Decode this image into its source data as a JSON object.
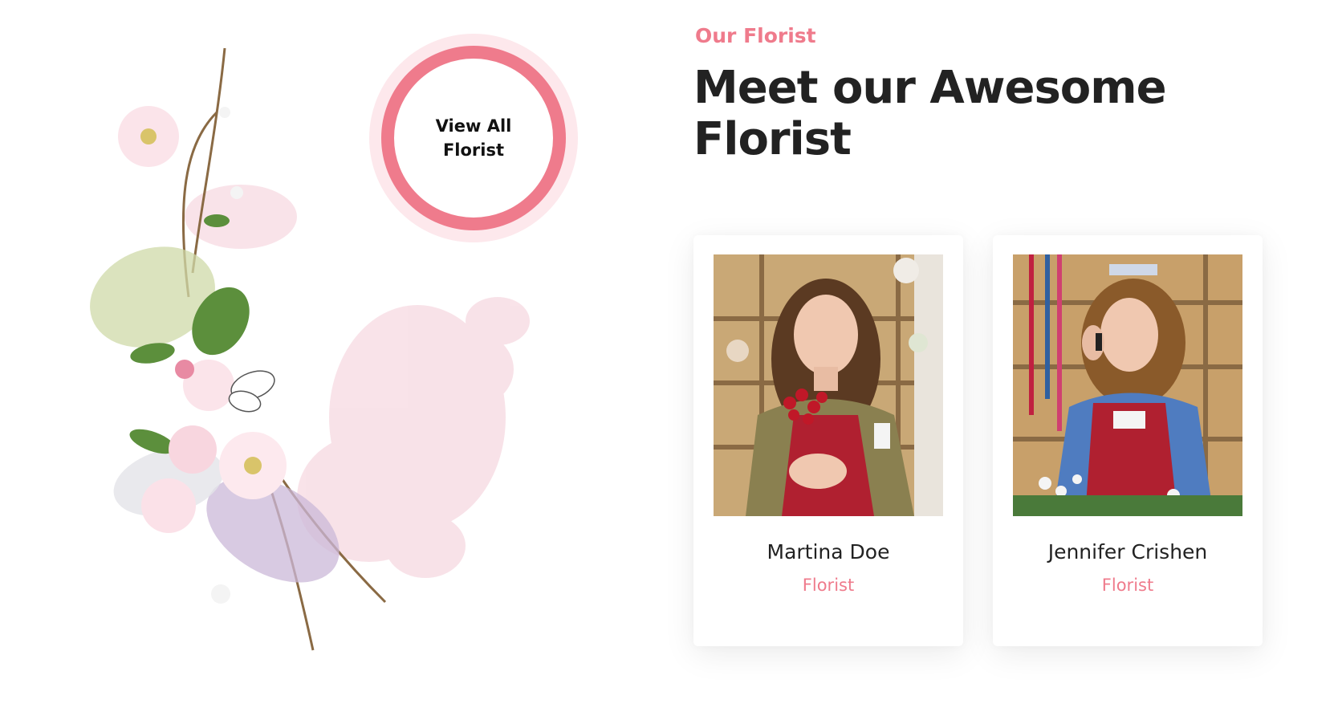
{
  "section": {
    "eyebrow": "Our Florist",
    "headline": "Meet our Awesome Florist"
  },
  "view_all": {
    "label": "View All Florist"
  },
  "florists": [
    {
      "name": "Martina Doe",
      "role": "Florist"
    },
    {
      "name": "Jennifer Crishen",
      "role": "Florist"
    }
  ],
  "colors": {
    "accent": "#ef7b8c",
    "accent_light": "#fde8ec",
    "heading": "#222222"
  }
}
